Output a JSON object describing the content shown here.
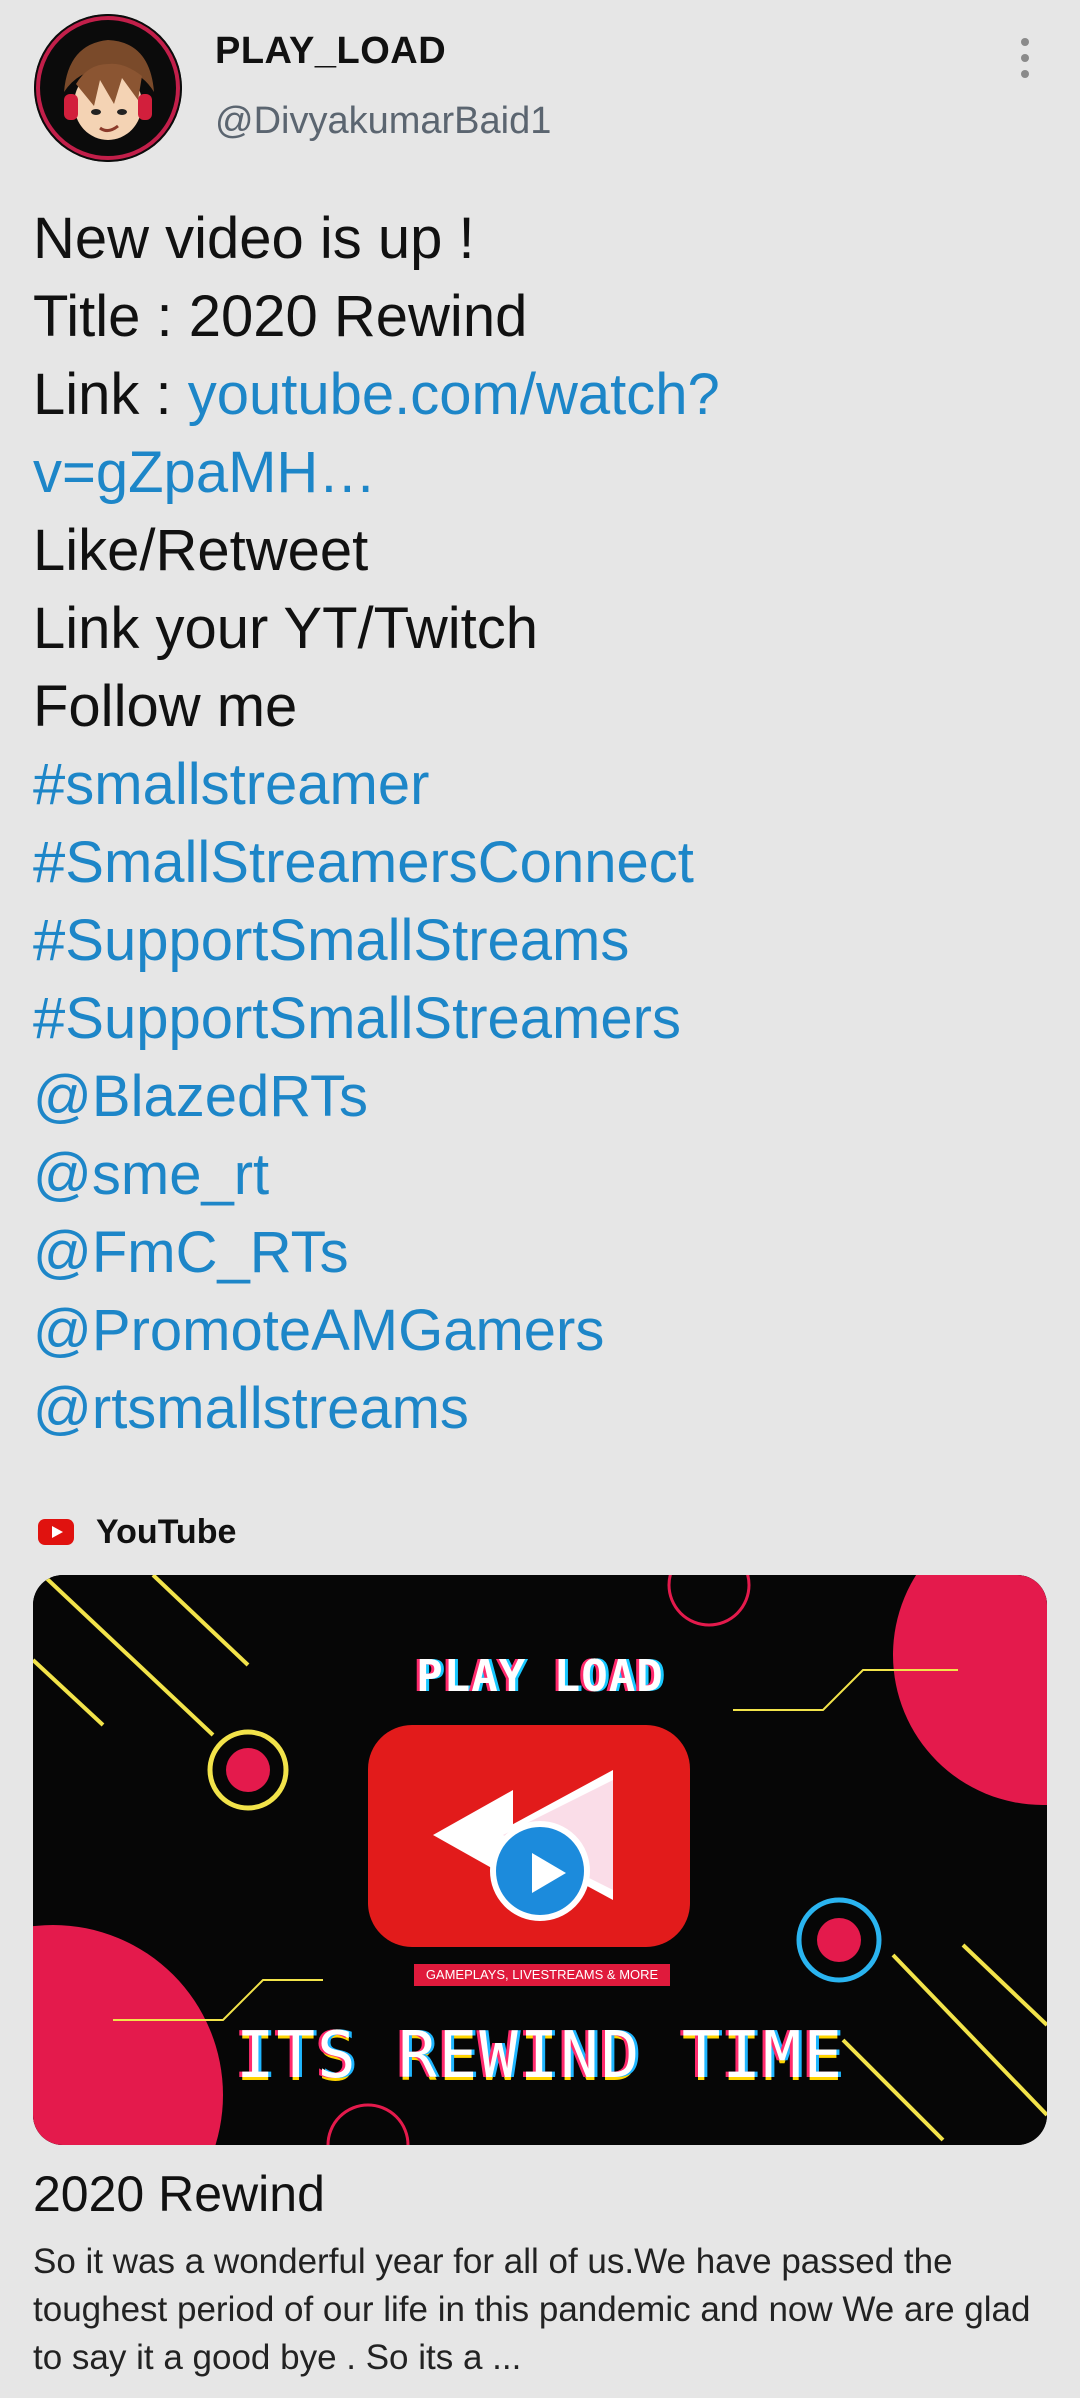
{
  "tweet": {
    "author": {
      "display_name": "PLAY_LOAD",
      "handle": "@DivyakumarBaid1"
    },
    "lines": [
      {
        "text": "New video is up !",
        "is_link": false
      },
      {
        "text": "Title : 2020 Rewind",
        "is_link": false
      },
      {
        "prefix": "Link : ",
        "text": "youtube.com/watch?",
        "is_link": true
      },
      {
        "text": "v=gZpaMH…",
        "is_link": true
      },
      {
        "text": "Like/Retweet",
        "is_link": false
      },
      {
        "text": "Link your YT/Twitch",
        "is_link": false
      },
      {
        "text": "Follow me",
        "is_link": false
      },
      {
        "text": "#smallstreamer",
        "is_link": true
      },
      {
        "text": "#SmallStreamersConnect",
        "is_link": true
      },
      {
        "text": "#SupportSmallStreams",
        "is_link": true
      },
      {
        "text": "#SupportSmallStreamers",
        "is_link": true
      },
      {
        "text": "@BlazedRTs",
        "is_link": true
      },
      {
        "text": "@sme_rt",
        "is_link": true
      },
      {
        "text": "@FmC_RTs",
        "is_link": true
      },
      {
        "text": "@PromoteAMGamers",
        "is_link": true
      },
      {
        "text": "@rtsmallstreams",
        "is_link": true
      }
    ]
  },
  "card": {
    "source": "YouTube",
    "source_icon": "youtube-icon",
    "thumbnail": {
      "title_text": "PLAY LOAD",
      "banner_text": "GAMEPLAYS, LIVESTREAMS & MORE",
      "headline_text": "ITS REWIND TIME",
      "icon": "play-icon"
    },
    "title": "2020 Rewind",
    "description": "So it was a wonderful year for all of us.We have passed the toughest period of our life in this pandemic and now We are glad to say it a good bye . So its a ..."
  },
  "icons": {
    "more": "more-vertical-icon"
  },
  "colors": {
    "background": "#e6e6e6",
    "link": "#1d86c8",
    "handle": "#5b6570",
    "youtube_red": "#e0120f",
    "play_blue": "#1c8bdc"
  }
}
